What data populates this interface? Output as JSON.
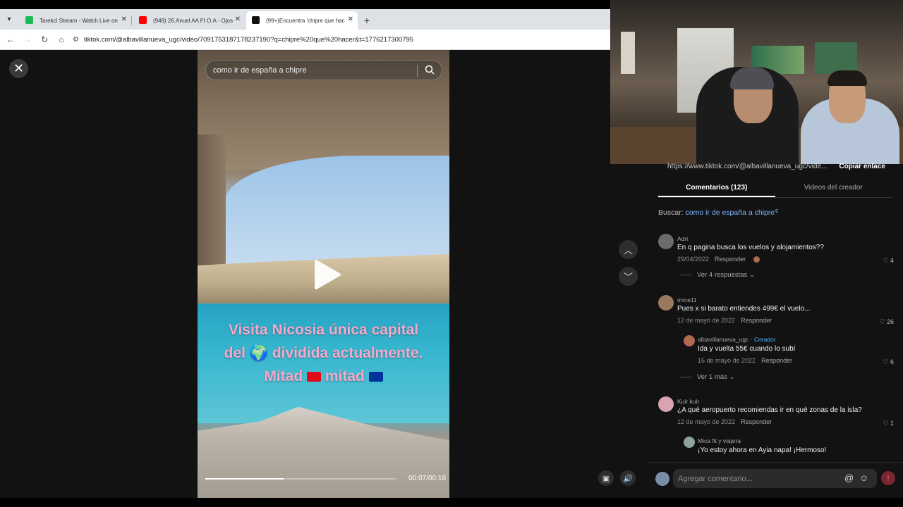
{
  "browser": {
    "tabs": [
      {
        "title": "Tarekcl Stream - Watch Live on",
        "favicon_color": "#1db954",
        "active": false
      },
      {
        "title": "(949) 26.Anuel AA Ft O.A - Ojos",
        "favicon_color": "#ff0000",
        "active": false
      },
      {
        "title": "(99+)Encuentra 'chipre que hac",
        "favicon_color": "#111111",
        "active": true
      }
    ],
    "new_tab_icon": "plus-icon",
    "url": "tiktok.com/@albavillanueva_ugc/video/7091753187178237190?q=chipre%20que%20hacer&t=1776217300795"
  },
  "video": {
    "search_text": "como ir de españa a chipre",
    "caption_line1": "Visita Nicosia única capital",
    "caption_line2_a": "del",
    "caption_line2_b": "dividida actualmente.",
    "caption_line3_a": "Mitad",
    "caption_line3_b": "mitad",
    "time": "00:07/00:18",
    "progress": 0.41
  },
  "panel": {
    "share_url": "https://www.tiktok.com/@albavillanueva_ugc/vide...",
    "copy_label": "Copiar enlace",
    "tab_comments": "Comentarios (123)",
    "tab_creator": "Videos del creador",
    "search_label": "Buscar:",
    "search_query": "como ir de españa a chipre",
    "reply_label": "Responder",
    "comments": [
      {
        "user": "Adri",
        "text": "En q pagina busca los vuelos y alojamientos??",
        "date": "29/04/2022",
        "likes": "4",
        "more": "Ver 4 respuestas",
        "avatar_color": "#6b6b6b"
      },
      {
        "user": "mrce11",
        "text": "Pues x si barato entiendes 499€ el vuelo...",
        "date": "12 de mayo de 2022",
        "likes": "26",
        "avatar_color": "#9a7a5e"
      },
      {
        "user": "albavillanueva_ugc",
        "creator_tag": "· Creador",
        "text": "Ida y vuelta 55€ cuando lo subí",
        "date": "16 de mayo de 2022",
        "likes": "6",
        "more": "Ver 1 más",
        "avatar_color": "#b06a50"
      },
      {
        "user": "Kuir kuir",
        "text": "¿A qué aeropuerto recomiendas ir en qué zonas de la isla?",
        "date": "12 de mayo de 2022",
        "likes": "1",
        "avatar_color": "#d9a4b0"
      },
      {
        "user": "Mica fit y viajera",
        "text": "¡Yo estoy ahora en Ayia napa! ¡Hermoso!",
        "avatar_color": "#8aa69a"
      }
    ],
    "input_placeholder": "Agregar comentario..."
  }
}
